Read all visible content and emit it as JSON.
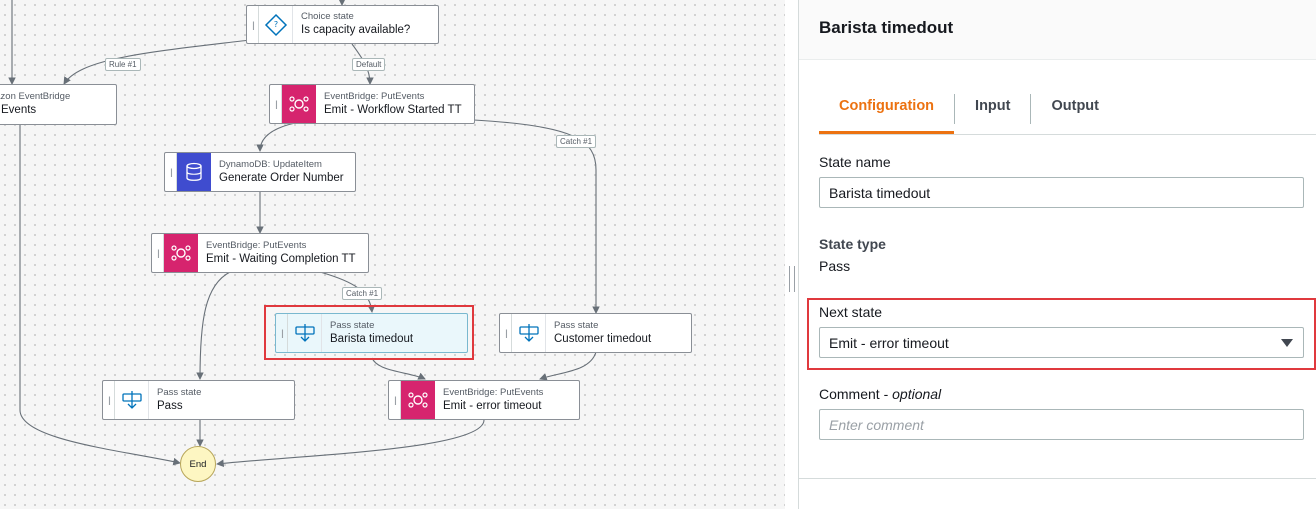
{
  "workflow": {
    "nodes": {
      "choice": {
        "type": "Choice state",
        "name": "Is capacity available?"
      },
      "eventbridge_left": {
        "type": "Amazon EventBridge",
        "name": "Events"
      },
      "emit_started": {
        "type": "EventBridge: PutEvents",
        "name": "Emit - Workflow Started TT"
      },
      "generate_order": {
        "type": "DynamoDB: UpdateItem",
        "name": "Generate Order Number"
      },
      "emit_waiting": {
        "type": "EventBridge: PutEvents",
        "name": "Emit - Waiting Completion TT"
      },
      "barista_timeout": {
        "type": "Pass state",
        "name": "Barista timedout"
      },
      "customer_timeout": {
        "type": "Pass state",
        "name": "Customer timedout"
      },
      "pass": {
        "type": "Pass state",
        "name": "Pass"
      },
      "emit_error": {
        "type": "EventBridge: PutEvents",
        "name": "Emit - error timeout"
      },
      "end": {
        "name": "End"
      }
    },
    "edge_labels": {
      "rule1": "Rule #1",
      "default": "Default",
      "catch1_a": "Catch #1",
      "catch1_b": "Catch #1"
    }
  },
  "panel": {
    "title": "Barista timedout",
    "tabs": [
      "Configuration",
      "Input",
      "Output"
    ],
    "active_tab": "Configuration",
    "state_name_label": "State name",
    "state_name_value": "Barista timedout",
    "state_type_label": "State type",
    "state_type_value": "Pass",
    "next_state_label": "Next state",
    "next_state_value": "Emit - error timeout",
    "comment_label": "Comment - ",
    "comment_optional": "optional",
    "comment_placeholder": "Enter comment"
  },
  "colors": {
    "accent": "#ec7211",
    "highlight": "#e0393e",
    "eventbridge": "#d6246e",
    "dynamodb": "#3f4ccf",
    "selected_node": "#eaf7fb",
    "end_node": "#fdf6c2"
  },
  "icons": {
    "choice": "choice-diamond-icon",
    "eventbridge": "eventbridge-icon",
    "dynamodb": "dynamodb-icon",
    "pass": "pass-state-icon"
  }
}
